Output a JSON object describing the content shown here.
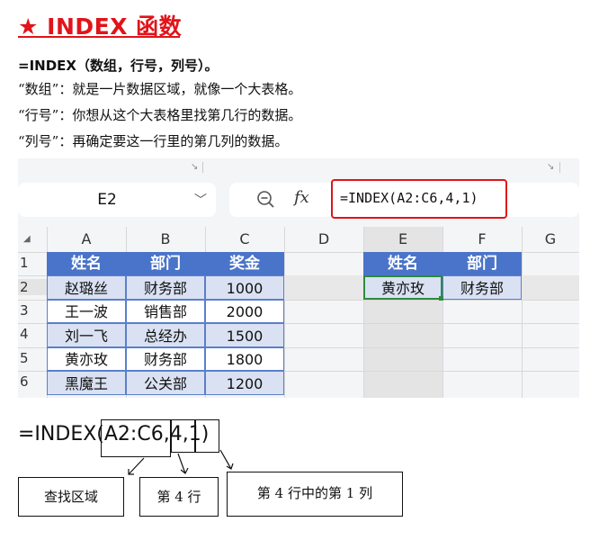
{
  "heading": {
    "star": "★",
    "title": "INDEX 函数"
  },
  "description": [
    "=INDEX（数组，行号，列号）。",
    "“数组”：就是一片数据区域，就像一个大表格。",
    "“行号”：你想从这个大表格里找第几行的数据。",
    "“列号”：再确定要这一行里的第几列的数据。"
  ],
  "spreadsheet": {
    "resize_glyph": "↘",
    "name_box": {
      "value": "E2",
      "chevron": "﹀"
    },
    "formula_bar": {
      "fx_label": "fx",
      "formula": "=INDEX(A2:C6,4,1)",
      "zoom_icon": "search-zoom"
    },
    "corner_glyph": "◢",
    "column_headers": [
      "A",
      "B",
      "C",
      "D",
      "E",
      "F",
      "G"
    ],
    "row_headers": [
      "1",
      "2",
      "3",
      "4",
      "5",
      "6"
    ],
    "source_table": {
      "headers": [
        "姓名",
        "部门",
        "奖金"
      ],
      "rows": [
        [
          "赵璐丝",
          "财务部",
          "1000"
        ],
        [
          "王一波",
          "销售部",
          "2000"
        ],
        [
          "刘一飞",
          "总经办",
          "1500"
        ],
        [
          "黄亦玫",
          "财务部",
          "1800"
        ],
        [
          "黑魔王",
          "公关部",
          "1200"
        ]
      ]
    },
    "result_table": {
      "headers": [
        "姓名",
        "部门"
      ],
      "row": [
        "黄亦玫",
        "财务部"
      ]
    },
    "colors": {
      "header_fill": "#4a74c9",
      "data_fill": "#d9e1f2",
      "highlight_border": "#e0141a",
      "selection": "#2e8b3e"
    }
  },
  "annotation": {
    "formula_parts": [
      "=INDEX(",
      "A2:C6",
      ",",
      "4",
      ",",
      "1",
      ")"
    ],
    "labels": [
      "查找区域",
      "第 4 行",
      "第 4 行中的第 1 列"
    ]
  }
}
